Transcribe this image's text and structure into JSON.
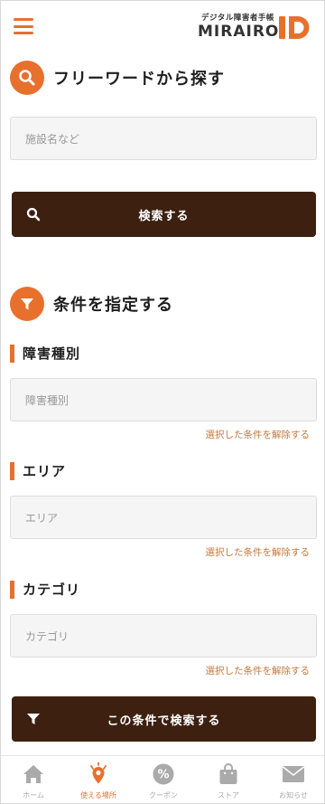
{
  "header": {
    "logo_tagline": "デジタル障害者手帳",
    "logo_name": "MIRAIRO",
    "accent": "#e8702d"
  },
  "freeword": {
    "title": "フリーワードから探す",
    "placeholder": "施設名など",
    "search_label": "検索する"
  },
  "conditions": {
    "title": "条件を指定する",
    "groups": [
      {
        "label": "障害種別",
        "placeholder": "障害種別",
        "clear_label": "選択した条件を解除する"
      },
      {
        "label": "エリア",
        "placeholder": "エリア",
        "clear_label": "選択した条件を解除する"
      },
      {
        "label": "カテゴリ",
        "placeholder": "カテゴリ",
        "clear_label": "選択した条件を解除する"
      }
    ],
    "submit_label": "この条件で検索する"
  },
  "bottom_nav": {
    "items": [
      {
        "label": "ホーム",
        "icon": "home-icon",
        "active": false
      },
      {
        "label": "使える場所",
        "icon": "location-pin-icon",
        "active": true
      },
      {
        "label": "クーポン",
        "icon": "coupon-percent-icon",
        "active": false
      },
      {
        "label": "ストア",
        "icon": "shopping-bag-icon",
        "active": false
      },
      {
        "label": "お知らせ",
        "icon": "mail-icon",
        "active": false
      }
    ]
  },
  "colors": {
    "accent": "#e8702d",
    "button_bg": "#3d2010",
    "link": "#c7783c",
    "nav_inactive": "#aaaaaa"
  }
}
